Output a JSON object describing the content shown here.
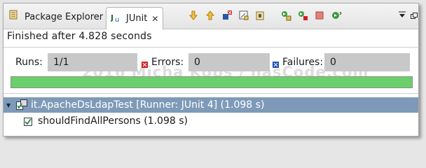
{
  "tabs": {
    "package_explorer": "Package Explorer",
    "junit": "JUnit",
    "junit_close": "✕"
  },
  "toolbar": {
    "icons": [
      "next-failure-icon",
      "previous-failure-icon",
      "show-failures-only-icon",
      "scroll-lock-icon",
      "show-skipped-icon",
      "rerun-icon",
      "rerun-failed-first-icon",
      "stop-icon",
      "history-icon",
      "view-menu-icon",
      "maximize-icon"
    ]
  },
  "status": "Finished after 4.828 seconds",
  "counters": {
    "runs_label": "Runs:",
    "runs_value": "1/1",
    "errors_label": "Errors:",
    "errors_value": "0",
    "failures_label": "Failures:",
    "failures_value": "0"
  },
  "progress": {
    "fraction": 1.0,
    "color": "#6ad06a"
  },
  "watermark": "2016 Micha Kops / hasCode.com",
  "tree": {
    "suite": "it.ApacheDsLdapTest [Runner: JUnit 4] (1.098 s)",
    "test": "shouldFindAllPersons (1.098 s)"
  },
  "colors": {
    "selection": "#7e9ab8",
    "error": "#d02020",
    "failure": "#2050b0"
  }
}
